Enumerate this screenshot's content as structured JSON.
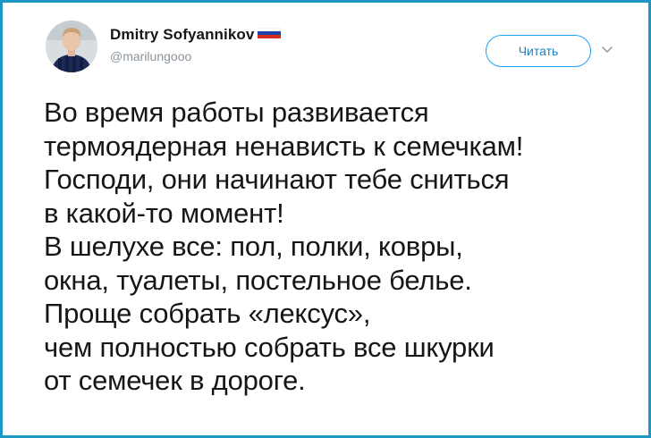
{
  "author": {
    "display_name": "Dmitry Sofyannikov",
    "handle": "@marilungooo",
    "flag_icon": "russia-flag-icon",
    "flag_colors": [
      "#ffffff",
      "#1c3faa",
      "#d52b1e"
    ],
    "avatar": "user-avatar"
  },
  "actions": {
    "follow_label": "Читать",
    "menu_icon": "chevron-down-icon"
  },
  "tweet": {
    "lines": [
      "Во время работы развивается",
      "термоядерная ненависть к семечкам!",
      "Господи, они начинают тебе сниться",
      "в какой-то момент!",
      "В шелухе все: пол, полки, ковры,",
      "окна, туалеты, постельное белье.",
      "Проще собрать «лексус»,",
      "чем полностью собрать все шкурки",
      "от семечек в дороге."
    ]
  },
  "colors": {
    "frame_border": "#1d97c4",
    "accent": "#1da1f2",
    "text": "#14171a",
    "secondary_text": "#8a949d"
  }
}
